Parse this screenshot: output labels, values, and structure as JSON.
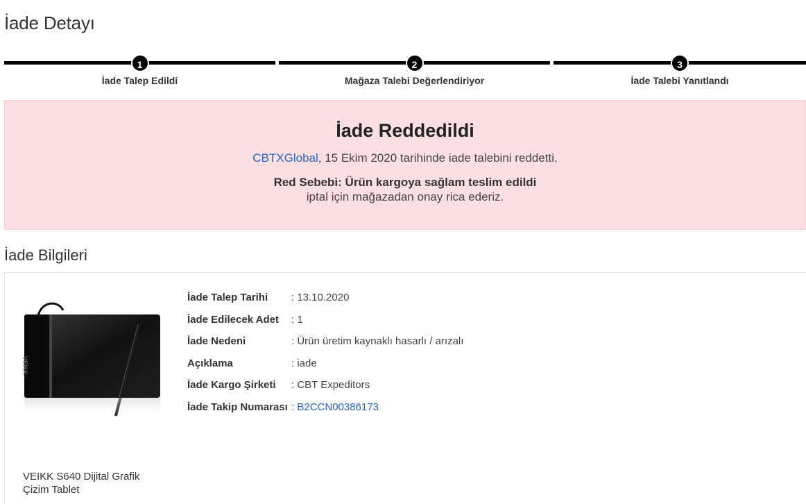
{
  "page": {
    "title": "İade Detayı"
  },
  "steps": [
    {
      "number": "1",
      "label": "İade Talep Edildi"
    },
    {
      "number": "2",
      "label": "Mağaza Talebi Değerlendiriyor"
    },
    {
      "number": "3",
      "label": "İade Talebi Yanıtlandı"
    }
  ],
  "rejection": {
    "title": "İade Reddedildi",
    "store": "CBTXGlobal",
    "message": ", 15 Ekim 2020 tarihinde iade talebini reddetti.",
    "reason_label": "Red Sebebi: Ürün kargoya sağlam teslim edildi",
    "reason_text": "iptal için mağazadan onay rica ederiz."
  },
  "section": {
    "title": "İade Bilgileri"
  },
  "product": {
    "name": "VEIKK S640 Dijital Grafik Çizim Tablet",
    "brand_mark": "VEIKK"
  },
  "details": [
    {
      "label": "İade Talep Tarihi",
      "value": ": 13.10.2020"
    },
    {
      "label": "İade Edilecek Adet",
      "value": ": 1"
    },
    {
      "label": "İade Nedeni",
      "value": ": Ürün üretim kaynaklı hasarlı / arızalı"
    },
    {
      "label": "Açıklama",
      "value": ": iade"
    },
    {
      "label": "İade Kargo Şirketi",
      "value": ": CBT Expeditors"
    },
    {
      "label": "İade Takip Numarası",
      "value_prefix": ": ",
      "value": "B2CCN00386173"
    }
  ],
  "colors": {
    "accent_link": "#2a64c6",
    "reject_bg": "#fcdfe1",
    "step_bar": "#000000"
  }
}
